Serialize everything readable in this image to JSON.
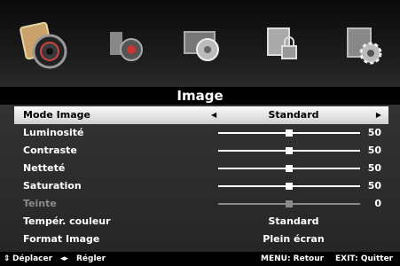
{
  "header": {
    "tabs": [
      {
        "name": "picture-icon",
        "selected": true
      },
      {
        "name": "sound-icon",
        "selected": false
      },
      {
        "name": "channel-icon",
        "selected": false
      },
      {
        "name": "lock-icon",
        "selected": false
      },
      {
        "name": "setup-icon",
        "selected": false
      }
    ]
  },
  "title": "Image",
  "menu": {
    "items": [
      {
        "label": "Mode Image",
        "value": "Standard",
        "selected": true
      },
      {
        "label": "Luminosité",
        "value": 50,
        "fraction": 0.5
      },
      {
        "label": "Contraste",
        "value": 50,
        "fraction": 0.5
      },
      {
        "label": "Netteté",
        "value": 50,
        "fraction": 0.5
      },
      {
        "label": "Saturation",
        "value": 50,
        "fraction": 0.5
      },
      {
        "label": "Teinte",
        "value": 0,
        "fraction": 0.5,
        "disabled": true
      },
      {
        "label": "Tempér. couleur",
        "value": "Standard"
      },
      {
        "label": "Format Image",
        "value": "Plein écran"
      }
    ]
  },
  "footer": {
    "move": "Déplacer",
    "adjust": "Régler",
    "back": "MENU: Retour",
    "exit": "EXIT: Quitter"
  },
  "colors": {
    "selected_row": "#e8e8e8",
    "panel": "#2b2b2b"
  }
}
